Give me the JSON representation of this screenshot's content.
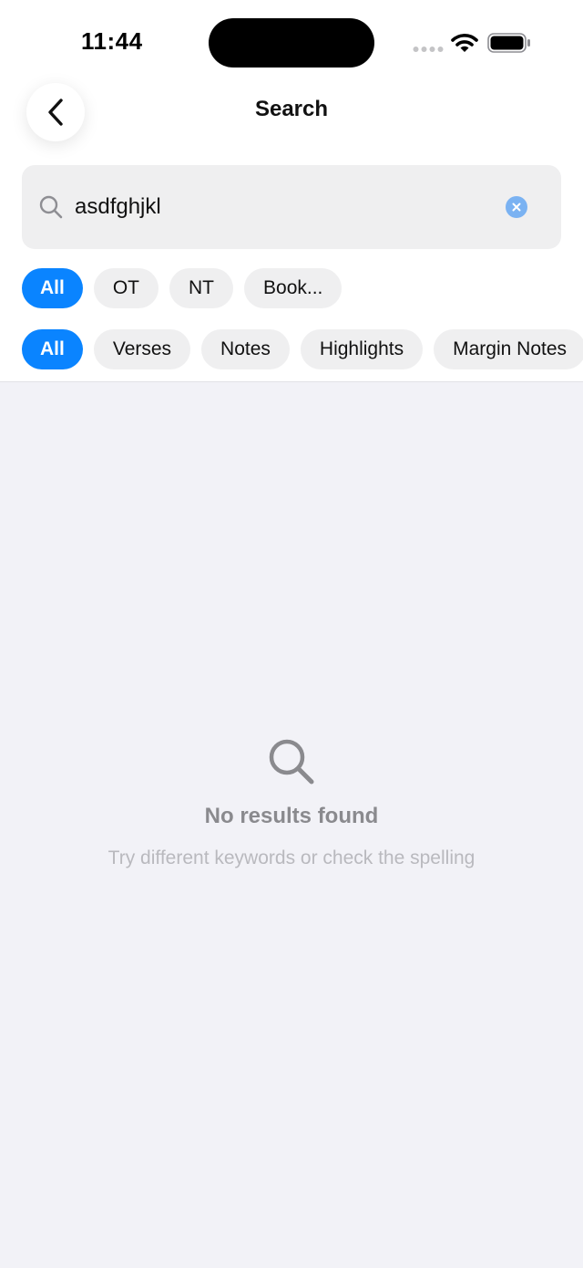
{
  "status_bar": {
    "time": "11:44"
  },
  "header": {
    "title": "Search",
    "back_icon": "chevron-left-icon"
  },
  "search": {
    "value": "asdfghjkl",
    "placeholder": "Search",
    "icon": "search-icon",
    "clear_icon": "clear-icon"
  },
  "scope_filters": [
    {
      "label": "All",
      "selected": true
    },
    {
      "label": "OT",
      "selected": false
    },
    {
      "label": "NT",
      "selected": false
    },
    {
      "label": "Book...",
      "selected": false
    }
  ],
  "type_filters": [
    {
      "label": "All",
      "selected": true
    },
    {
      "label": "Verses",
      "selected": false
    },
    {
      "label": "Notes",
      "selected": false
    },
    {
      "label": "Highlights",
      "selected": false
    },
    {
      "label": "Margin Notes",
      "selected": false
    }
  ],
  "empty_state": {
    "icon": "search-icon",
    "title": "No results found",
    "subtitle": "Try different keywords or check the spelling"
  },
  "colors": {
    "accent": "#0A84FF",
    "background": "#F2F2F7",
    "chip": "#EFEFF0"
  }
}
